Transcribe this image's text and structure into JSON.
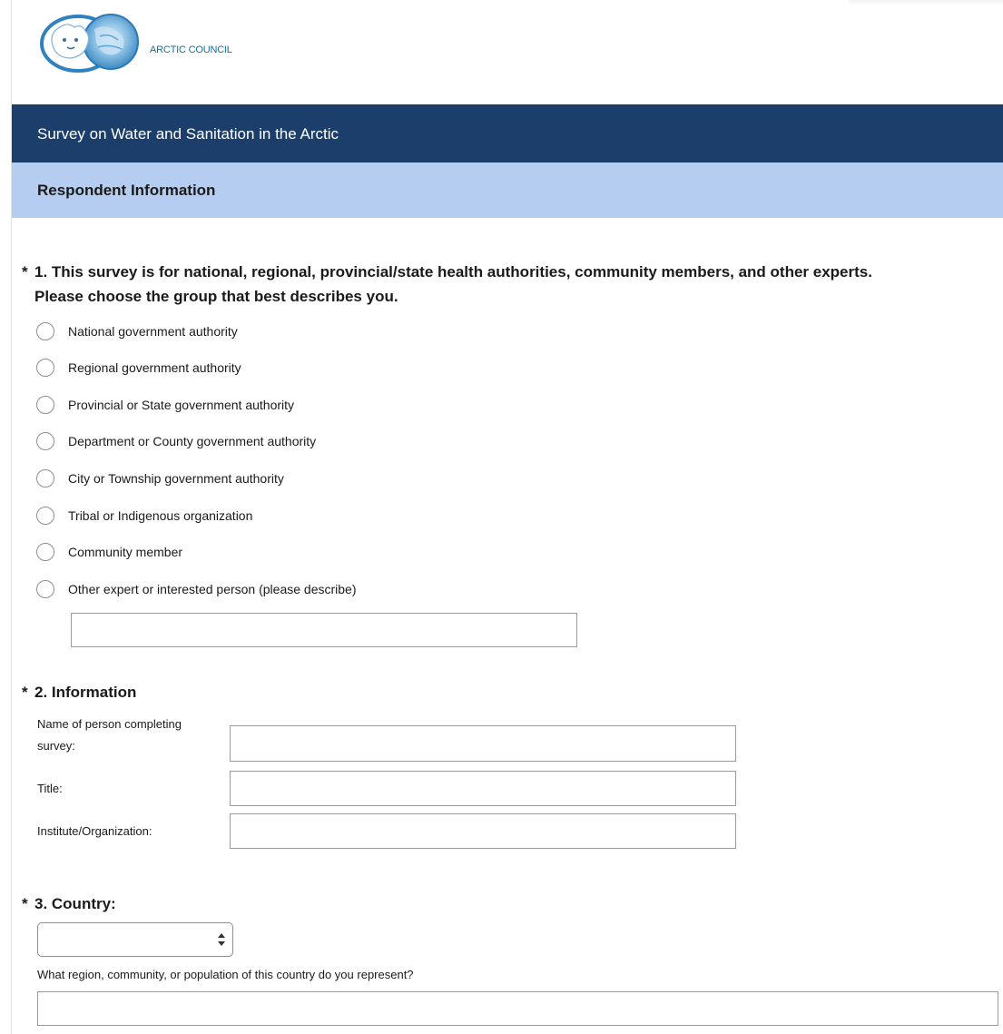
{
  "logo": {
    "text": "ARCTIC COUNCIL"
  },
  "survey": {
    "title": "Survey on Water and Sanitation in the Arctic",
    "section_title": "Respondent Information"
  },
  "required_marker": "*",
  "q1": {
    "line1": "1. This survey is for national, regional, provincial/state health authorities, community members, and other experts.",
    "line2": "Please choose the group that best describes you.",
    "options": [
      "National government authority",
      "Regional government authority",
      "Provincial or State government authority",
      "Department or County government authority",
      "City or Township government authority",
      "Tribal or Indigenous organization",
      "Community member",
      "Other expert or interested person (please describe)"
    ],
    "other_value": ""
  },
  "q2": {
    "title": "2. Information",
    "fields": [
      {
        "label": "Name of person completing survey:",
        "value": ""
      },
      {
        "label": "Title:",
        "value": ""
      },
      {
        "label": "Institute/Organization:",
        "value": ""
      }
    ]
  },
  "q3": {
    "title": "3. Country:",
    "selected": "",
    "region_label": "What region, community, or population of this country do you represent?",
    "region_value": ""
  }
}
